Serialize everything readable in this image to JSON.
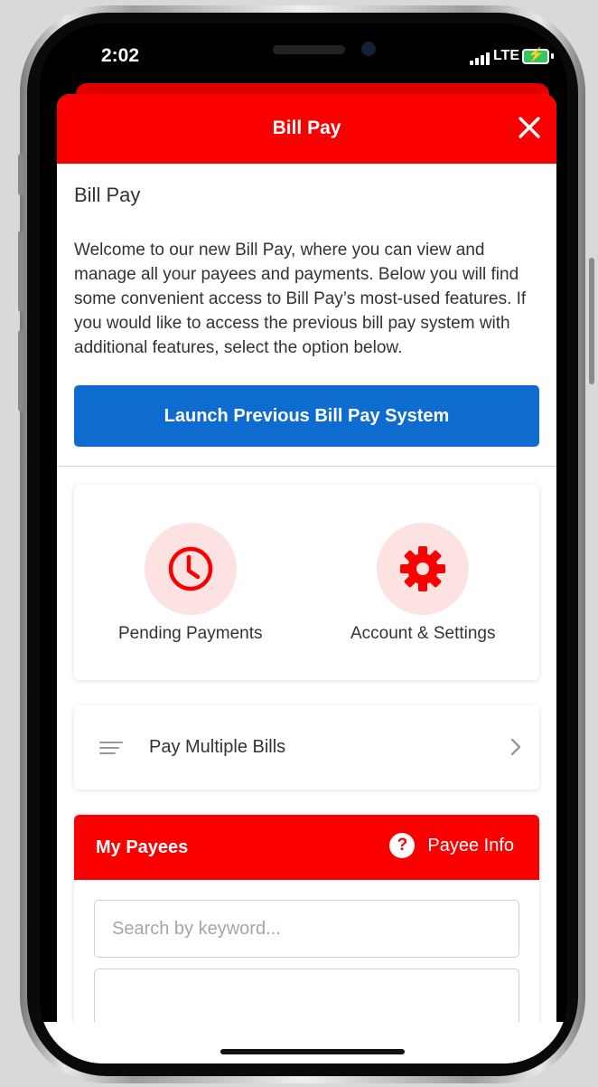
{
  "status_bar": {
    "time": "2:02",
    "network": "LTE"
  },
  "modal": {
    "header_title": "Bill Pay",
    "intro_title": "Bill Pay",
    "intro_text": "Welcome to our new Bill Pay, where you can view and manage all your payees and payments. Below you will find some convenient access to Bill Pay’s most-used features. If you would like to access the previous bill pay system with additional features, select the option below.",
    "launch_button": "Launch Previous Bill Pay System"
  },
  "quick_actions": [
    {
      "label": "Pending Payments",
      "icon": "clock-icon"
    },
    {
      "label": "Account & Settings",
      "icon": "gear-icon"
    }
  ],
  "pay_multiple": {
    "label": "Pay Multiple Bills",
    "icon": "lines-icon"
  },
  "payees": {
    "title": "My Payees",
    "info_label": "Payee Info",
    "search_placeholder": "Search by keyword..."
  },
  "colors": {
    "brand_red": "#fb0000",
    "primary_blue": "#0e6bd0",
    "icon_bg": "#fde2e2"
  }
}
